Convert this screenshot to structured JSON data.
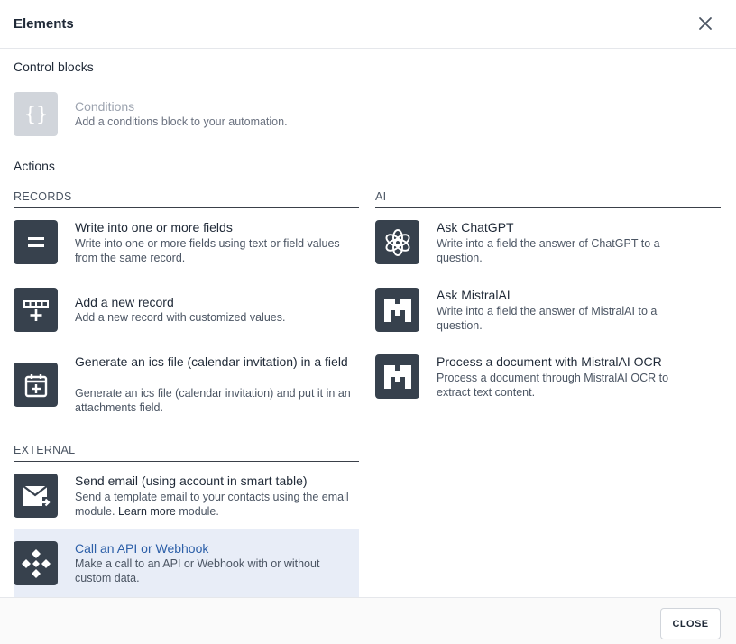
{
  "modal": {
    "title": "Elements",
    "close_label": "CLOSE"
  },
  "control_blocks": {
    "title": "Control blocks",
    "items": [
      {
        "title": "Conditions",
        "desc": "Add a conditions block to your automation.",
        "icon": "braces-icon",
        "disabled": true
      }
    ]
  },
  "actions": {
    "title": "Actions",
    "records": {
      "heading": "RECORDS",
      "items": [
        {
          "title": "Write into one or more fields",
          "desc": "Write into one or more fields using text or field values from the same record.",
          "icon": "equals-icon"
        },
        {
          "title": "Add a new record",
          "desc": "Add a new record with customized values.",
          "icon": "add-row-icon"
        },
        {
          "title": "Generate an ics file (calendar invitation) in a field",
          "desc": "Generate an ics file (calendar invitation) and put it in an attachments field.",
          "icon": "calendar-add-icon"
        }
      ]
    },
    "ai": {
      "heading": "AI",
      "items": [
        {
          "title": "Ask ChatGPT",
          "desc": "Write into a field the answer of ChatGPT to a question.",
          "icon": "openai-icon"
        },
        {
          "title": "Ask MistralAI",
          "desc": "Write into a field the answer of MistralAI to a question.",
          "icon": "mistral-icon"
        },
        {
          "title": "Process a document with MistralAI OCR",
          "desc": "Process a document through MistralAI OCR to extract text content.",
          "icon": "mistral-icon"
        }
      ]
    },
    "external": {
      "heading": "EXTERNAL",
      "items": [
        {
          "title": "Send email (using account in smart table)",
          "desc_before": "Send a template email to your contacts using the email module. ",
          "desc_link": "Learn more",
          "desc_after": " module.",
          "icon": "email-send-icon"
        },
        {
          "title": "Call an API or Webhook",
          "desc": "Make a call to an API or Webhook with or without custom data.",
          "icon": "webhook-icon",
          "highlighted": true
        }
      ]
    }
  },
  "colors": {
    "icon_bg": "#37414d",
    "icon_disabled_bg": "#d1d5db",
    "highlight_bg": "#e8edf7",
    "highlight_text": "#2c5fa8"
  }
}
